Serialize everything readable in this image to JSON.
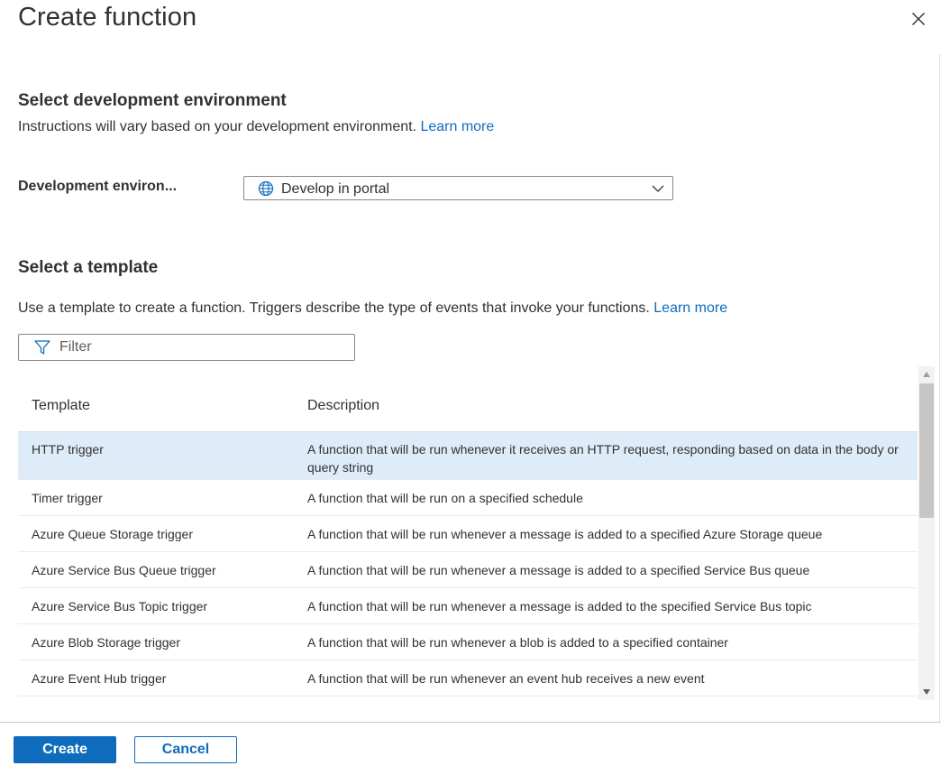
{
  "dialog": {
    "title": "Create function"
  },
  "dev_env": {
    "heading": "Select development environment",
    "description": "Instructions will vary based on your development environment.",
    "learn_more": "Learn more",
    "field_label": "Development environ...",
    "selected_value": "Develop in portal"
  },
  "template": {
    "heading": "Select a template",
    "description": "Use a template to create a function. Triggers describe the type of events that invoke your functions.",
    "learn_more": "Learn more",
    "filter_placeholder": "Filter",
    "columns": [
      "Template",
      "Description"
    ],
    "rows": [
      {
        "name": "HTTP trigger",
        "description": "A function that will be run whenever it receives an HTTP request, responding based on data in the body or query string",
        "selected": true
      },
      {
        "name": "Timer trigger",
        "description": "A function that will be run on a specified schedule"
      },
      {
        "name": "Azure Queue Storage trigger",
        "description": "A function that will be run whenever a message is added to a specified Azure Storage queue"
      },
      {
        "name": "Azure Service Bus Queue trigger",
        "description": "A function that will be run whenever a message is added to a specified Service Bus queue"
      },
      {
        "name": "Azure Service Bus Topic trigger",
        "description": "A function that will be run whenever a message is added to the specified Service Bus topic"
      },
      {
        "name": "Azure Blob Storage trigger",
        "description": "A function that will be run whenever a blob is added to a specified container"
      },
      {
        "name": "Azure Event Hub trigger",
        "description": "A function that will be run whenever an event hub receives a new event"
      }
    ]
  },
  "footer": {
    "create_label": "Create",
    "cancel_label": "Cancel"
  },
  "colors": {
    "accent": "#0f6cbd",
    "selected_row": "#deecf9"
  }
}
